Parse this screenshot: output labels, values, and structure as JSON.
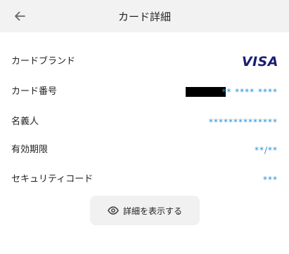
{
  "header": {
    "title": "カード詳細",
    "back_icon": "arrow-left-icon"
  },
  "rows": [
    {
      "label": "カードブランド",
      "value": "VISA"
    },
    {
      "label": "カード番号",
      "value": "** **** ****"
    },
    {
      "label": "名義人",
      "value": "**************"
    },
    {
      "label": "有効期限",
      "value": "**/**"
    },
    {
      "label": "セキュリティコード",
      "value": "***"
    }
  ],
  "show_button": {
    "label": "詳細を表示する",
    "icon": "eye-icon"
  },
  "colors": {
    "accent": "#2a8fd6",
    "brand": "#1a1f71",
    "header_bg": "#f2f2f2",
    "button_bg": "#f1f1f1"
  }
}
